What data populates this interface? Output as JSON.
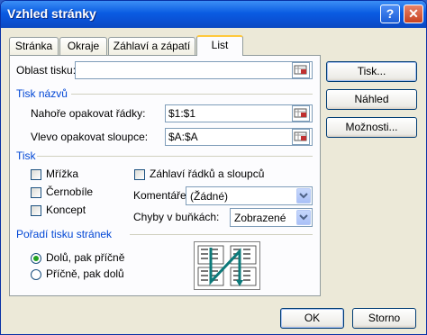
{
  "window": {
    "title": "Vzhled stránky",
    "help_label": "?",
    "close_label": "✕"
  },
  "tabs": [
    "Stránka",
    "Okraje",
    "Záhlaví a zápatí",
    "List"
  ],
  "print_area": {
    "label": "Oblast tisku:",
    "value": ""
  },
  "titles_section": {
    "label": "Tisk názvů"
  },
  "rows_repeat": {
    "label": "Nahoře opakovat řádky:",
    "value": "$1:$1"
  },
  "cols_repeat": {
    "label": "Vlevo opakovat sloupce:",
    "value": "$A:$A"
  },
  "print_section": {
    "label": "Tisk"
  },
  "checks": {
    "gridlines": {
      "label": "Mřížka",
      "checked": false
    },
    "bw": {
      "label": "Černobíle",
      "checked": false
    },
    "draft": {
      "label": "Koncept",
      "checked": false
    },
    "headings": {
      "label": "Záhlaví řádků a sloupců",
      "checked": false
    }
  },
  "comments": {
    "label": "Komentáře:",
    "value": "(Žádné)"
  },
  "errors": {
    "label": "Chyby v buňkách:",
    "value": "Zobrazené"
  },
  "order_section": {
    "label": "Pořadí tisku stránek"
  },
  "order": {
    "down_then_over": "Dolů, pak příčně",
    "over_then_down": "Příčně, pak dolů",
    "selected": "down_then_over"
  },
  "buttons": {
    "print": "Tisk...",
    "preview": "Náhled",
    "options": "Možnosti...",
    "ok": "OK",
    "cancel": "Storno"
  },
  "icons": {
    "range_picker": "range-picker-icon",
    "dropdown": "chevron-down-icon",
    "page_order": "page-order-preview-icon"
  }
}
